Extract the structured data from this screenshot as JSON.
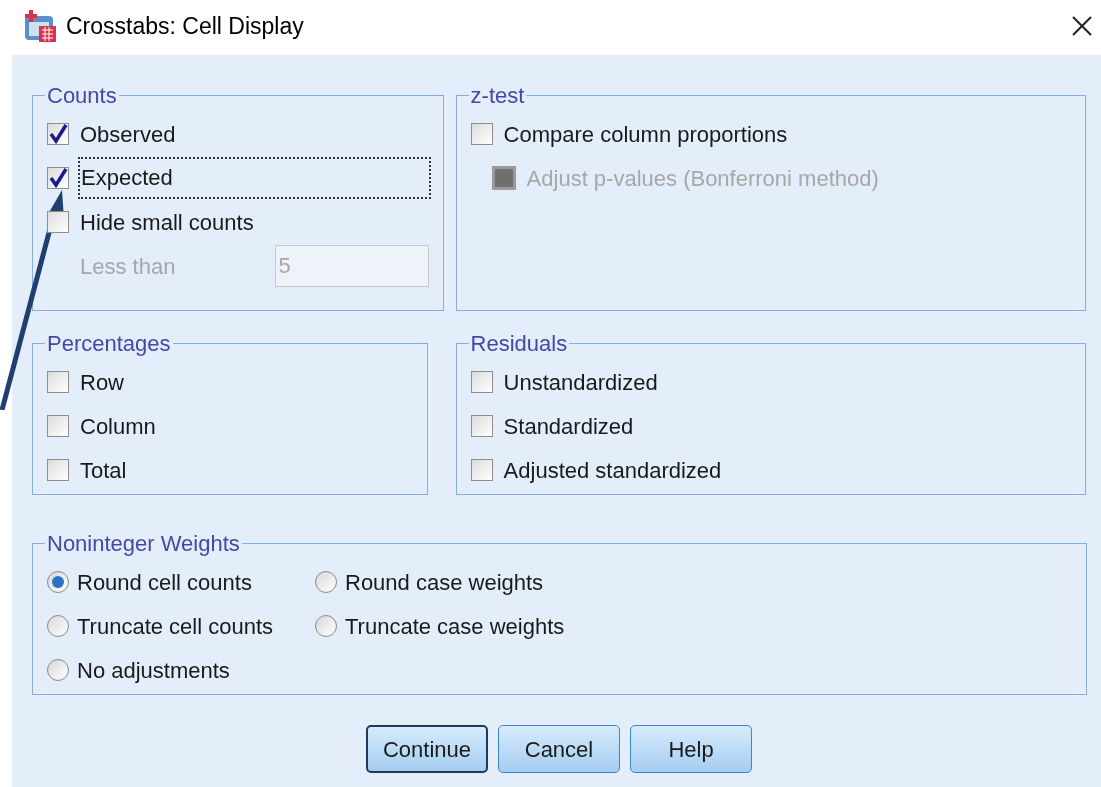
{
  "window": {
    "title": "Crosstabs: Cell Display"
  },
  "counts": {
    "title": "Counts",
    "options": [
      {
        "label": "Observed",
        "checked": true,
        "focused": false
      },
      {
        "label": "Expected",
        "checked": true,
        "focused": true
      },
      {
        "label": "Hide small counts",
        "checked": false,
        "focused": false
      }
    ],
    "less_than": {
      "label": "Less than",
      "value": "5",
      "disabled": true
    }
  },
  "z_test": {
    "title": "z-test",
    "options": [
      {
        "label": "Compare column proportions",
        "checked": false,
        "disabled": false,
        "children": [
          {
            "label": "Adjust p-values (Bonferroni method)",
            "checked": false,
            "disabled": true
          }
        ]
      }
    ]
  },
  "percentages": {
    "title": "Percentages",
    "options": [
      {
        "label": "Row",
        "checked": false
      },
      {
        "label": "Column",
        "checked": false
      },
      {
        "label": "Total",
        "checked": false
      }
    ]
  },
  "residuals": {
    "title": "Residuals",
    "options": [
      {
        "label": "Unstandardized",
        "checked": false
      },
      {
        "label": "Standardized",
        "checked": false
      },
      {
        "label": "Adjusted standardized",
        "checked": false
      }
    ]
  },
  "noninteger_weights": {
    "title": "Noninteger Weights",
    "options": [
      {
        "label": "Round cell counts",
        "selected": true
      },
      {
        "label": "Round case weights",
        "selected": false
      },
      {
        "label": "Truncate cell counts",
        "selected": false
      },
      {
        "label": "Truncate case weights",
        "selected": false
      },
      {
        "label": "No adjustments",
        "selected": false
      }
    ]
  },
  "buttons": [
    {
      "label": "Continue",
      "default": true
    },
    {
      "label": "Cancel",
      "default": false
    },
    {
      "label": "Help",
      "default": false
    }
  ]
}
